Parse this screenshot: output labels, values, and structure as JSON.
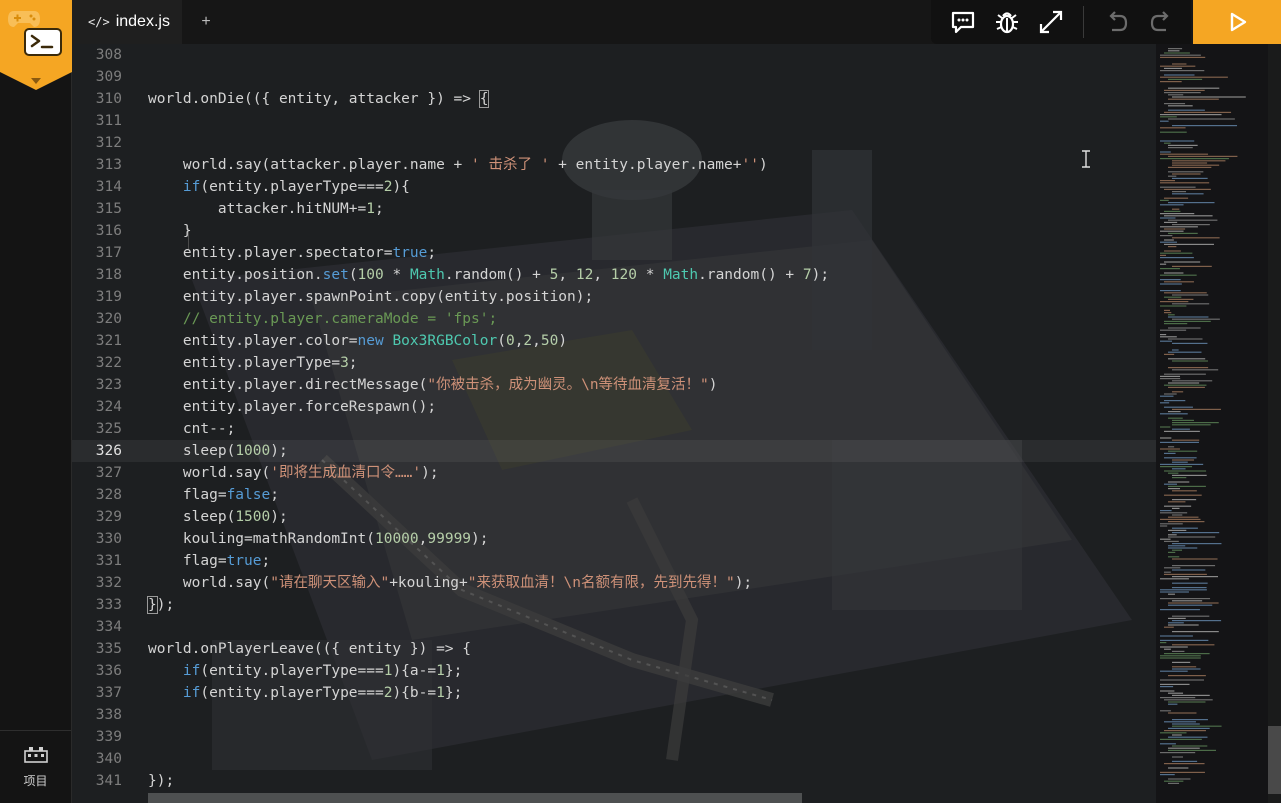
{
  "tabs": {
    "active_label": "index.js",
    "add_label": "+"
  },
  "toolbar": {
    "icons": [
      "chat-icon",
      "bug-icon",
      "expand-icon",
      "undo-icon",
      "redo-icon",
      "play-icon"
    ]
  },
  "sidebar": {
    "project_label": "项目"
  },
  "editor": {
    "active_line": "326",
    "lines": [
      {
        "no": "308",
        "code": ""
      },
      {
        "no": "309",
        "code": ""
      },
      {
        "no": "310",
        "code": "world.onDie(({ entity, attacker }) => {"
      },
      {
        "no": "311",
        "code": ""
      },
      {
        "no": "312",
        "code": ""
      },
      {
        "no": "313",
        "code": "    world.say(attacker.player.name + ' 击杀了 ' + entity.player.name+'')"
      },
      {
        "no": "314",
        "code": "    if(entity.playerType===2){"
      },
      {
        "no": "315",
        "code": "        attacker.hitNUM+=1;"
      },
      {
        "no": "316",
        "code": "    }"
      },
      {
        "no": "317",
        "code": "    entity.player.spectator=true;"
      },
      {
        "no": "318",
        "code": "    entity.position.set(100 * Math.random() + 5, 12, 120 * Math.random() + 7);"
      },
      {
        "no": "319",
        "code": "    entity.player.spawnPoint.copy(entity.position);"
      },
      {
        "no": "320",
        "code": "    // entity.player.cameraMode = 'fps';"
      },
      {
        "no": "321",
        "code": "    entity.player.color=new Box3RGBColor(0,2,50)"
      },
      {
        "no": "322",
        "code": "    entity.playerType=3;"
      },
      {
        "no": "323",
        "code": "    entity.player.directMessage(\"你被击杀，成为幽灵。\\n等待血清复活！\")"
      },
      {
        "no": "324",
        "code": "    entity.player.forceRespawn();"
      },
      {
        "no": "325",
        "code": "    cnt--;"
      },
      {
        "no": "326",
        "code": "    sleep(1000);"
      },
      {
        "no": "327",
        "code": "    world.say('即将生成血清口令……');"
      },
      {
        "no": "328",
        "code": "    flag=false;"
      },
      {
        "no": "329",
        "code": "    sleep(1500);"
      },
      {
        "no": "330",
        "code": "    kouling=mathRandomInt(10000,99999);"
      },
      {
        "no": "331",
        "code": "    flag=true;"
      },
      {
        "no": "332",
        "code": "    world.say(\"请在聊天区输入\"+kouling+\"来获取血清！\\n名额有限，先到先得！\");"
      },
      {
        "no": "333",
        "code": "});"
      },
      {
        "no": "334",
        "code": ""
      },
      {
        "no": "335",
        "code": "world.onPlayerLeave(({ entity }) => {"
      },
      {
        "no": "336",
        "code": "    if(entity.playerType===1){a-=1};"
      },
      {
        "no": "337",
        "code": "    if(entity.playerType===2){b-=1};"
      },
      {
        "no": "338",
        "code": ""
      },
      {
        "no": "339",
        "code": ""
      },
      {
        "no": "340",
        "code": ""
      },
      {
        "no": "341",
        "code": "});"
      }
    ]
  },
  "colors": {
    "accent": "#f5a623",
    "keyword": "#569cd6",
    "number": "#b5cea8",
    "string": "#ce9178",
    "comment": "#6a9955",
    "type": "#4ec9b0"
  }
}
